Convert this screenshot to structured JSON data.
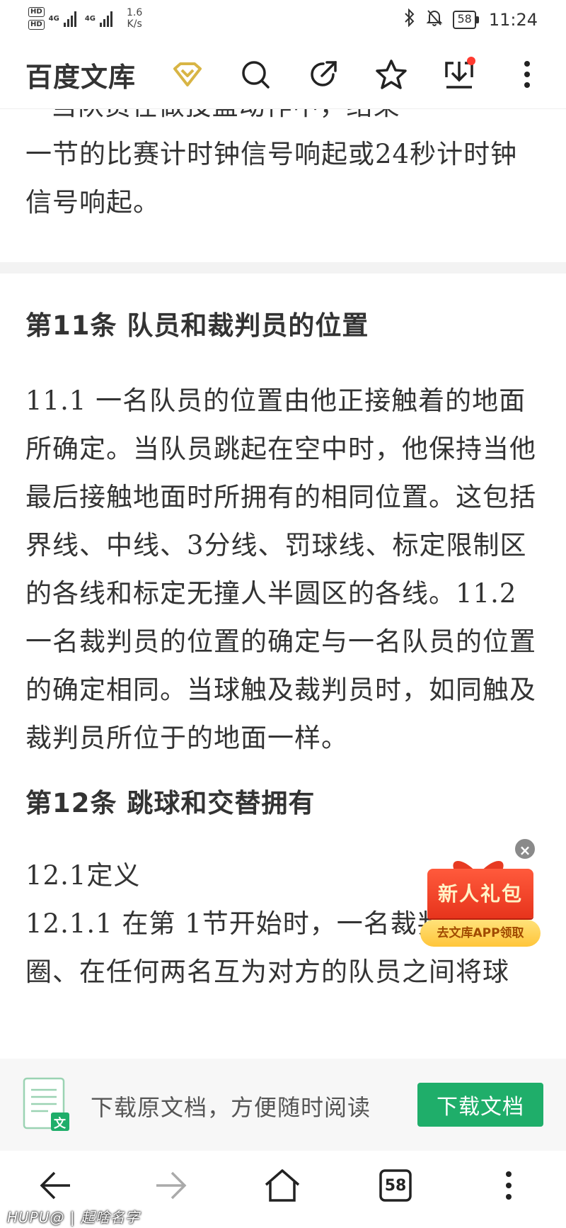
{
  "status_bar": {
    "network_1": "4G",
    "network_2": "4G",
    "hd": "HD",
    "speed_value": "1.6",
    "speed_unit": "K/s",
    "battery": "58",
    "time": "11:24"
  },
  "header": {
    "brand": "百度文库",
    "icons": [
      "vip-diamond-icon",
      "search-icon",
      "share-icon",
      "star-icon",
      "download-icon",
      "more-icon"
    ]
  },
  "content": {
    "prev_tail_cut": "• 当队员在做投篮动作中，结束",
    "prev_tail": "一节的比赛计时钟信号响起或24秒计时钟信号响起。",
    "section11_title": "第11条 队员和裁判员的位置",
    "section11_body": "11.1 一名队员的位置由他正接触着的地面所确定。当队员跳起在空中时，他保持当他最后接触地面时所拥有的相同位置。这包括界线、中线、3分线、罚球线、标定限制区的各线和标定无撞人半圆区的各线。11.2 一名裁判员的位置的确定与一名队员的位置的确定相同。当球触及裁判员时，如同触及裁判员所位于的地面一样。",
    "section12_title": "第12条 跳球和交替拥有",
    "section12_sub": "12.1定义",
    "section12_body": "12.1.1 在第 1节开始时，一名裁判员在中圈、在任何两名互为对方的队员之间将球"
  },
  "gift_popup": {
    "title": "新人礼包",
    "subtitle": "去文库APP领取"
  },
  "download_bar": {
    "text": "下载原文档，方便随时阅读",
    "button": "下载文档",
    "doc_badge": "文"
  },
  "browser_nav": {
    "tab_count": "58"
  },
  "watermark": "HUPU@ | 起啥名字",
  "colors": {
    "accent_green": "#1fae6a",
    "vip_gold": "#d8b545",
    "red_dot": "#ff3b30"
  }
}
